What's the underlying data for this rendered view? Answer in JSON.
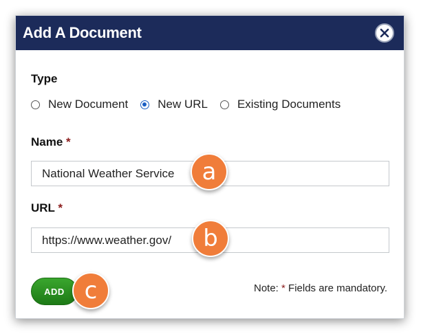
{
  "dialog": {
    "title": "Add A Document",
    "close_icon": "close-icon"
  },
  "type_section": {
    "label": "Type",
    "options": [
      {
        "label": "New Document",
        "selected": false
      },
      {
        "label": "New URL",
        "selected": true
      },
      {
        "label": "Existing Documents",
        "selected": false
      }
    ]
  },
  "name_field": {
    "label": "Name",
    "required_mark": "*",
    "value": "National Weather Service"
  },
  "url_field": {
    "label": "URL",
    "required_mark": "*",
    "value": "https://www.weather.gov/"
  },
  "actions": {
    "add_label": "ADD"
  },
  "note": {
    "prefix": "Note:",
    "mark": "*",
    "text": "Fields are mandatory."
  },
  "markers": [
    "a",
    "b",
    "c"
  ],
  "colors": {
    "titlebar": "#1c2b5a",
    "marker": "#f07d3a",
    "add_button": "#2a8f22",
    "required": "#8b1c1c",
    "radio_selected": "#1a5fc4"
  }
}
